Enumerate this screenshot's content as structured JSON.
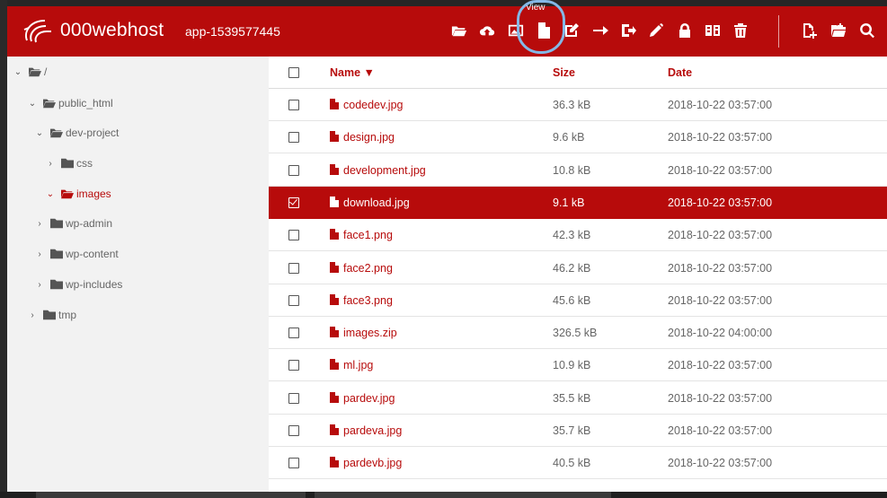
{
  "header": {
    "brand": "000webhost",
    "app_name": "app-1539577445",
    "tooltip": "View",
    "toolbar": [
      {
        "name": "open-folder-icon",
        "glyph": "folder-open"
      },
      {
        "name": "upload-icon",
        "glyph": "cloud-upload"
      },
      {
        "name": "image-icon",
        "glyph": "image"
      },
      {
        "name": "view-file-icon",
        "glyph": "file"
      },
      {
        "name": "edit-icon",
        "glyph": "edit"
      },
      {
        "name": "move-icon",
        "glyph": "arrow-right"
      },
      {
        "name": "sign-out-icon",
        "glyph": "sign-out"
      },
      {
        "name": "rename-icon",
        "glyph": "pencil"
      },
      {
        "name": "lock-icon",
        "glyph": "lock"
      },
      {
        "name": "compress-icon",
        "glyph": "archive"
      },
      {
        "name": "delete-icon",
        "glyph": "trash"
      },
      {
        "name": "new-file-icon",
        "glyph": "file-plus"
      },
      {
        "name": "new-folder-icon",
        "glyph": "folder-plus"
      },
      {
        "name": "search-icon",
        "glyph": "search"
      }
    ]
  },
  "sidebar": {
    "items": [
      {
        "label": "/",
        "level": 0,
        "expanded": true,
        "open": true,
        "active": false
      },
      {
        "label": "public_html",
        "level": 1,
        "expanded": true,
        "open": true,
        "active": false
      },
      {
        "label": "dev-project",
        "level": 2,
        "expanded": true,
        "open": true,
        "active": false
      },
      {
        "label": "css",
        "level": 3,
        "expanded": false,
        "open": false,
        "active": false
      },
      {
        "label": "images",
        "level": 3,
        "expanded": true,
        "open": true,
        "active": true
      },
      {
        "label": "wp-admin",
        "level": 2,
        "expanded": false,
        "open": false,
        "active": false
      },
      {
        "label": "wp-content",
        "level": 2,
        "expanded": false,
        "open": false,
        "active": false
      },
      {
        "label": "wp-includes",
        "level": 2,
        "expanded": false,
        "open": false,
        "active": false
      },
      {
        "label": "tmp",
        "level": 1,
        "expanded": false,
        "open": false,
        "active": false
      }
    ]
  },
  "table": {
    "columns": {
      "name": "Name ▼",
      "size": "Size",
      "date": "Date"
    },
    "rows": [
      {
        "name": "codedev.jpg",
        "size": "36.3 kB",
        "date": "2018-10-22 03:57:00",
        "selected": false
      },
      {
        "name": "design.jpg",
        "size": "9.6 kB",
        "date": "2018-10-22 03:57:00",
        "selected": false
      },
      {
        "name": "development.jpg",
        "size": "10.8 kB",
        "date": "2018-10-22 03:57:00",
        "selected": false
      },
      {
        "name": "download.jpg",
        "size": "9.1 kB",
        "date": "2018-10-22 03:57:00",
        "selected": true
      },
      {
        "name": "face1.png",
        "size": "42.3 kB",
        "date": "2018-10-22 03:57:00",
        "selected": false
      },
      {
        "name": "face2.png",
        "size": "46.2 kB",
        "date": "2018-10-22 03:57:00",
        "selected": false
      },
      {
        "name": "face3.png",
        "size": "45.6 kB",
        "date": "2018-10-22 03:57:00",
        "selected": false
      },
      {
        "name": "images.zip",
        "size": "326.5 kB",
        "date": "2018-10-22 04:00:00",
        "selected": false
      },
      {
        "name": "ml.jpg",
        "size": "10.9 kB",
        "date": "2018-10-22 03:57:00",
        "selected": false
      },
      {
        "name": "pardev.jpg",
        "size": "35.5 kB",
        "date": "2018-10-22 03:57:00",
        "selected": false
      },
      {
        "name": "pardeva.jpg",
        "size": "35.7 kB",
        "date": "2018-10-22 03:57:00",
        "selected": false
      },
      {
        "name": "pardevb.jpg",
        "size": "40.5 kB",
        "date": "2018-10-22 03:57:00",
        "selected": false
      }
    ]
  },
  "colors": {
    "accent": "#b70b0b",
    "sidebar_bg": "#f2f2f2",
    "text_gray": "#666666",
    "highlight_ring": "#84b8e6"
  }
}
